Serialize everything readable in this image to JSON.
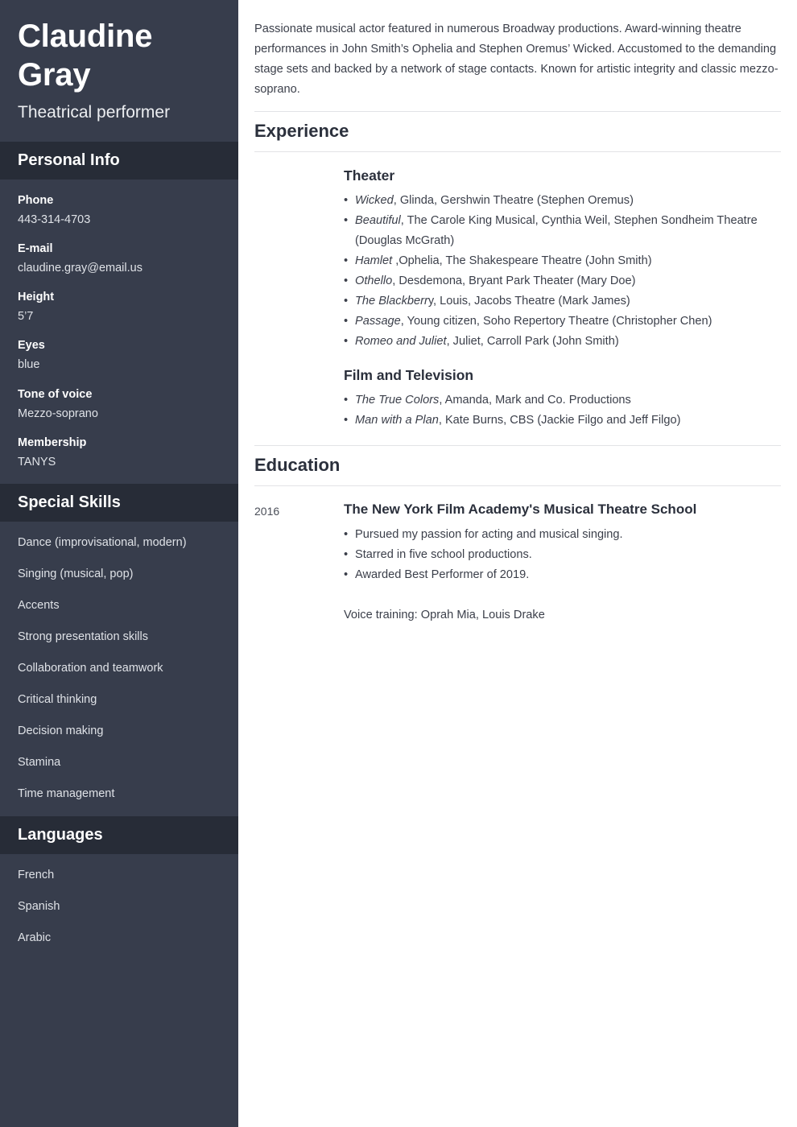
{
  "sidebar": {
    "name": "Claudine Gray",
    "role": "Theatrical performer",
    "personal_info": {
      "heading": "Personal Info",
      "fields": [
        {
          "label": "Phone",
          "value": "443-314-4703"
        },
        {
          "label": "E-mail",
          "value": "claudine.gray@email.us"
        },
        {
          "label": "Height",
          "value": "5’7"
        },
        {
          "label": "Eyes",
          "value": "blue"
        },
        {
          "label": "Tone of voice",
          "value": "Mezzo-soprano"
        },
        {
          "label": "Membership",
          "value": "TANYS"
        }
      ]
    },
    "special_skills": {
      "heading": "Special Skills",
      "items": [
        "Dance (improvisational, modern)",
        "Singing (musical, pop)",
        "Accents",
        "Strong presentation skills",
        "Collaboration and teamwork",
        "Critical thinking",
        "Decision making",
        "Stamina",
        "Time management"
      ]
    },
    "languages": {
      "heading": "Languages",
      "items": [
        "French",
        "Spanish",
        "Arabic"
      ]
    }
  },
  "main": {
    "summary": "Passionate musical actor featured in numerous Broadway productions. Award-winning theatre performances in John Smith’s Ophelia and Stephen Oremus’ Wicked. Accustomed to the demanding stage sets and backed by a network of stage contacts. Known for artistic integrity and classic mezzo-soprano.",
    "experience": {
      "heading": "Experience",
      "groups": [
        {
          "title": "Theater",
          "items": [
            {
              "italic": "Wicked",
              "rest": ", Glinda, Gershwin Theatre (Stephen Oremus)"
            },
            {
              "italic": "Beautiful",
              "rest": ", The Carole King Musical, Cynthia Weil, Stephen Sondheim Theatre (Douglas McGrath)"
            },
            {
              "italic": "Hamlet ",
              "rest": ",Ophelia, The Shakespeare Theatre (John Smith)"
            },
            {
              "italic": "Othello",
              "rest": ", Desdemona, Bryant Park Theater (Mary Doe)"
            },
            {
              "italic": "The Blackberr",
              "rest": "y, Louis, Jacobs Theatre (Mark James)"
            },
            {
              "italic": "Passage",
              "rest": ", Young citizen, Soho Repertory Theatre (Christopher Chen)"
            },
            {
              "italic": "Romeo and Juliet",
              "rest": ", Juliet, Carroll Park (John Smith)"
            }
          ]
        },
        {
          "title": "Film and Television",
          "items": [
            {
              "italic": "The True Colors",
              "rest": ", Amanda, Mark and Co. Productions"
            },
            {
              "italic": "Man with a Plan",
              "rest": ", Kate Burns, CBS (Jackie Filgo and Jeff Filgo)"
            }
          ]
        }
      ]
    },
    "education": {
      "heading": "Education",
      "date": "2016",
      "school": "The New York Film Academy's Musical Theatre School",
      "bullets": [
        "Pursued my passion for acting and musical singing.",
        "Starred in five school productions.",
        "Awarded Best Performer of 2019."
      ],
      "note": "Voice training: Oprah Mia, Louis Drake"
    }
  },
  "colors": {
    "sidebar_bg": "#373d4c",
    "sidebar_header_bg": "#272c37",
    "text_dark": "#2b303c",
    "rule": "#e2e3e6"
  }
}
